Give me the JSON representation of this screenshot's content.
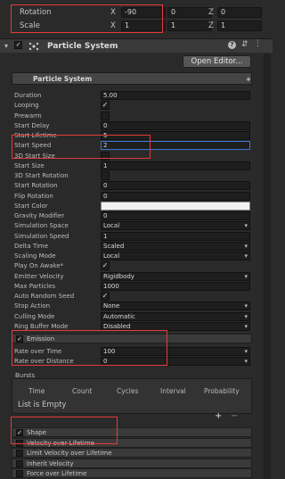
{
  "transform": {
    "rotation": {
      "label": "Rotation",
      "x": "-90",
      "y": "0",
      "z": "0"
    },
    "scale": {
      "label": "Scale",
      "x": "1",
      "y": "1",
      "z": "1"
    },
    "axis_x": "X",
    "axis_y": "Y",
    "axis_z": "Z"
  },
  "component": {
    "title": "Particle System",
    "open_editor_label": "Open Editor...",
    "module_title": "Particle System"
  },
  "properties": [
    {
      "label": "Duration",
      "value": "5.00",
      "kind": "field"
    },
    {
      "label": "Looping",
      "value": "✓",
      "kind": "check"
    },
    {
      "label": "Prewarm",
      "value": "",
      "kind": "check"
    },
    {
      "label": "Start Delay",
      "value": "0",
      "kind": "field"
    },
    {
      "label": "Start Lifetime",
      "value": "5",
      "kind": "field"
    },
    {
      "label": "Start Speed",
      "value": "2",
      "kind": "focus"
    },
    {
      "label": "3D Start Size",
      "value": "",
      "kind": "check"
    },
    {
      "label": "Start Size",
      "value": "1",
      "kind": "field"
    },
    {
      "label": "3D Start Rotation",
      "value": "",
      "kind": "check"
    },
    {
      "label": "Start Rotation",
      "value": "0",
      "kind": "field"
    },
    {
      "label": "Flip Rotation",
      "value": "0",
      "kind": "field"
    },
    {
      "label": "Start Color",
      "value": "",
      "kind": "color"
    },
    {
      "label": "Gravity Modifier",
      "value": "0",
      "kind": "field"
    },
    {
      "label": "Simulation Space",
      "value": "Local",
      "kind": "dropdown"
    },
    {
      "label": "Simulation Speed",
      "value": "1",
      "kind": "field"
    },
    {
      "label": "Delta Time",
      "value": "Scaled",
      "kind": "dropdown"
    },
    {
      "label": "Scaling Mode",
      "value": "Local",
      "kind": "dropdown"
    },
    {
      "label": "Play On Awake*",
      "value": "✓",
      "kind": "check"
    },
    {
      "label": "Emitter Velocity",
      "value": "Rigidbody",
      "kind": "dropdown"
    },
    {
      "label": "Max Particles",
      "value": "1000",
      "kind": "field"
    },
    {
      "label": "Auto Random Seed",
      "value": "✓",
      "kind": "check"
    },
    {
      "label": "Stop Action",
      "value": "None",
      "kind": "dropdown"
    },
    {
      "label": "Culling Mode",
      "value": "Automatic",
      "kind": "dropdown"
    },
    {
      "label": "Ring Buffer Mode",
      "value": "Disabled",
      "kind": "dropdown"
    }
  ],
  "emission": {
    "title": "Emission",
    "checked": "✓",
    "rate_over_time": {
      "label": "Rate over Time",
      "value": "100"
    },
    "rate_over_distance": {
      "label": "Rate over Distance",
      "value": "0"
    },
    "bursts_label": "Bursts",
    "columns": [
      "Time",
      "Count",
      "Cycles",
      "Interval",
      "Probability"
    ],
    "empty_text": "List is Empty",
    "add_label": "+",
    "remove_label": "−"
  },
  "modules": [
    {
      "label": "Shape",
      "checked": "✓"
    },
    {
      "label": "Velocity over Lifetime",
      "checked": ""
    },
    {
      "label": "Limit Velocity over Lifetime",
      "checked": ""
    },
    {
      "label": "Inherit Velocity",
      "checked": ""
    },
    {
      "label": "Force over Lifetime",
      "checked": ""
    }
  ],
  "colors": {
    "accent_red": "#e53a3a",
    "focus_blue": "#3a79d6",
    "background": "#2a2a2a"
  }
}
